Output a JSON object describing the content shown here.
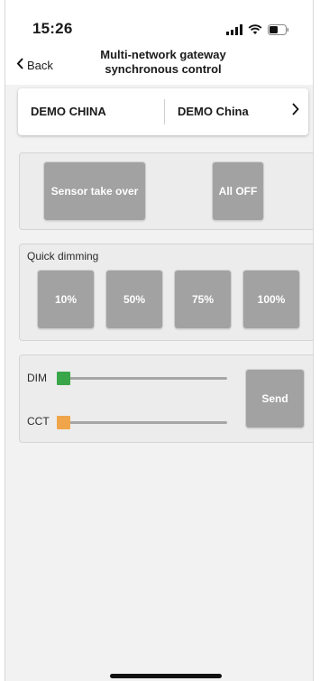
{
  "status_bar": {
    "time": "15:26",
    "icons": [
      "signal-icon",
      "wifi-icon",
      "battery-icon"
    ]
  },
  "nav": {
    "back_label": "Back",
    "title_line1": "Multi-network gateway",
    "title_line2": "synchronous control"
  },
  "gateway": {
    "left_name": "DEMO CHINA",
    "right_name": "DEMO China"
  },
  "actions": {
    "sensor_label": "Sensor take over",
    "all_off_label": "All OFF"
  },
  "quick_dimming": {
    "label": "Quick dimming",
    "options": [
      "10%",
      "50%",
      "75%",
      "100%"
    ]
  },
  "sliders": {
    "dim_label": "DIM",
    "cct_label": "CCT",
    "dim_value": 0,
    "cct_value": 0,
    "send_label": "Send",
    "colors": {
      "dim": "#3aa64a",
      "cct": "#f0a54a"
    }
  }
}
